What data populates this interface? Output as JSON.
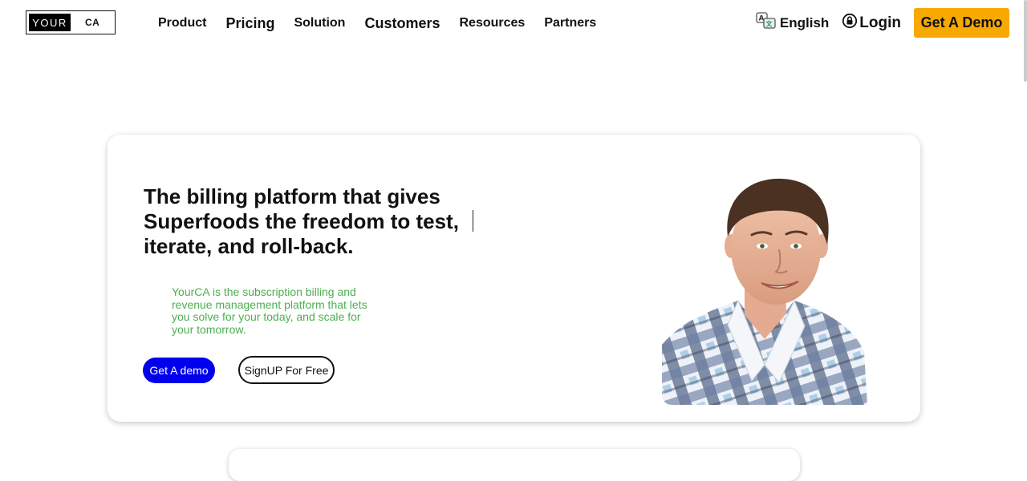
{
  "header": {
    "logo_left": "YOUR",
    "logo_right": "CA",
    "nav": [
      {
        "label": "Product",
        "size": "sm"
      },
      {
        "label": "Pricing",
        "size": "lg"
      },
      {
        "label": "Solution",
        "size": "sm"
      },
      {
        "label": "Customers",
        "size": "lg"
      },
      {
        "label": "Resources",
        "size": "sm"
      },
      {
        "label": "Partners",
        "size": "sm"
      }
    ],
    "language": "English",
    "login": "Login",
    "demo": "Get A Demo"
  },
  "hero": {
    "headline": "The billing platform that gives Superfoods the freedom to test, iterate, and roll-back.",
    "description": "YourCA is the subscription billing and revenue management platform that lets you solve for your today, and scale for your tomorrow.",
    "demo_button": "Get A demo",
    "signup_button": "SignUP For Free"
  },
  "colors": {
    "accent_orange": "#f8a900",
    "primary_blue": "#0000ee",
    "description_green": "#4caf50"
  }
}
